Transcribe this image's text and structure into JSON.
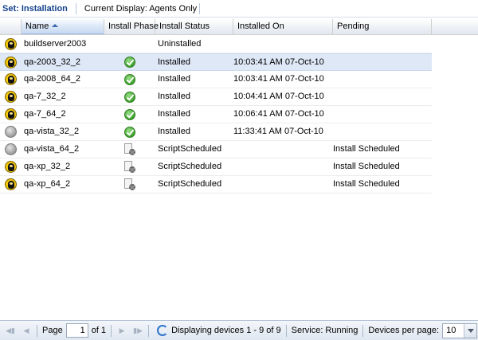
{
  "toolbar": {
    "set_label": "Set: Installation",
    "display_label": "Current Display: Agents Only"
  },
  "colors": {
    "accent": "#15428b",
    "selected_row": "#dfe8f6",
    "agent_icon": "#f2c70c",
    "success": "#3ea22c"
  },
  "grid": {
    "columns": [
      "Name",
      "Install Phase",
      "Install Status",
      "Installed On",
      "Pending"
    ],
    "sorted_column": "Name",
    "rows": [
      {
        "agent_icon": "agent-online-icon",
        "name": "buildserver2003",
        "phase_icon": "",
        "status": "Uninstalled",
        "installed_on": "",
        "pending": ""
      },
      {
        "agent_icon": "agent-online-icon",
        "name": "qa-2003_32_2",
        "phase_icon": "check-icon",
        "status": "Installed",
        "installed_on": "10:03:41 AM 07-Oct-10",
        "pending": "",
        "selected": true
      },
      {
        "agent_icon": "agent-online-icon",
        "name": "qa-2008_64_2",
        "phase_icon": "check-icon",
        "status": "Installed",
        "installed_on": "10:03:41 AM 07-Oct-10",
        "pending": ""
      },
      {
        "agent_icon": "agent-online-icon",
        "name": "qa-7_32_2",
        "phase_icon": "check-icon",
        "status": "Installed",
        "installed_on": "10:04:41 AM 07-Oct-10",
        "pending": ""
      },
      {
        "agent_icon": "agent-online-icon",
        "name": "qa-7_64_2",
        "phase_icon": "check-icon",
        "status": "Installed",
        "installed_on": "10:06:41 AM 07-Oct-10",
        "pending": ""
      },
      {
        "agent_icon": "agent-offline-icon",
        "name": "qa-vista_32_2",
        "phase_icon": "check-icon",
        "status": "Installed",
        "installed_on": "11:33:41 AM 07-Oct-10",
        "pending": ""
      },
      {
        "agent_icon": "agent-offline-icon",
        "name": "qa-vista_64_2",
        "phase_icon": "script-scheduled-icon",
        "status": "ScriptScheduled",
        "installed_on": "",
        "pending": "Install Scheduled"
      },
      {
        "agent_icon": "agent-online-icon",
        "name": "qa-xp_32_2",
        "phase_icon": "script-scheduled-icon",
        "status": "ScriptScheduled",
        "installed_on": "",
        "pending": "Install Scheduled"
      },
      {
        "agent_icon": "agent-online-icon",
        "name": "qa-xp_64_2",
        "phase_icon": "script-scheduled-icon",
        "status": "ScriptScheduled",
        "installed_on": "",
        "pending": "Install Scheduled"
      }
    ]
  },
  "pager": {
    "page_label": "Page",
    "page_value": "1",
    "of_label": "of 1",
    "display_text": "Displaying devices 1 - 9 of 9",
    "service_text": "Service: Running",
    "per_page_label": "Devices per page:",
    "per_page_value": "10"
  }
}
